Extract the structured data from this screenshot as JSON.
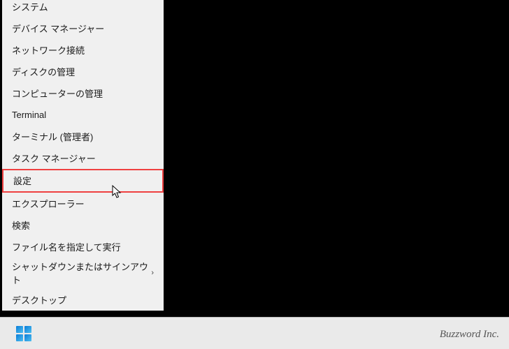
{
  "menu": {
    "items": [
      {
        "label": "システム",
        "highlighted": false,
        "submenu": false
      },
      {
        "label": "デバイス マネージャー",
        "highlighted": false,
        "submenu": false
      },
      {
        "label": "ネットワーク接続",
        "highlighted": false,
        "submenu": false
      },
      {
        "label": "ディスクの管理",
        "highlighted": false,
        "submenu": false
      },
      {
        "label": "コンピューターの管理",
        "highlighted": false,
        "submenu": false
      },
      {
        "label": "Terminal",
        "highlighted": false,
        "submenu": false
      },
      {
        "label": "ターミナル (管理者)",
        "highlighted": false,
        "submenu": false
      },
      {
        "label": "タスク マネージャー",
        "highlighted": false,
        "submenu": false
      },
      {
        "label": "設定",
        "highlighted": true,
        "submenu": false
      },
      {
        "label": "エクスプローラー",
        "highlighted": false,
        "submenu": false
      },
      {
        "label": "検索",
        "highlighted": false,
        "submenu": false
      },
      {
        "label": "ファイル名を指定して実行",
        "highlighted": false,
        "submenu": false
      },
      {
        "label": "シャットダウンまたはサインアウト",
        "highlighted": false,
        "submenu": true
      },
      {
        "label": "デスクトップ",
        "highlighted": false,
        "submenu": false
      }
    ],
    "submenu_indicator": "›"
  },
  "watermark": "Buzzword Inc."
}
